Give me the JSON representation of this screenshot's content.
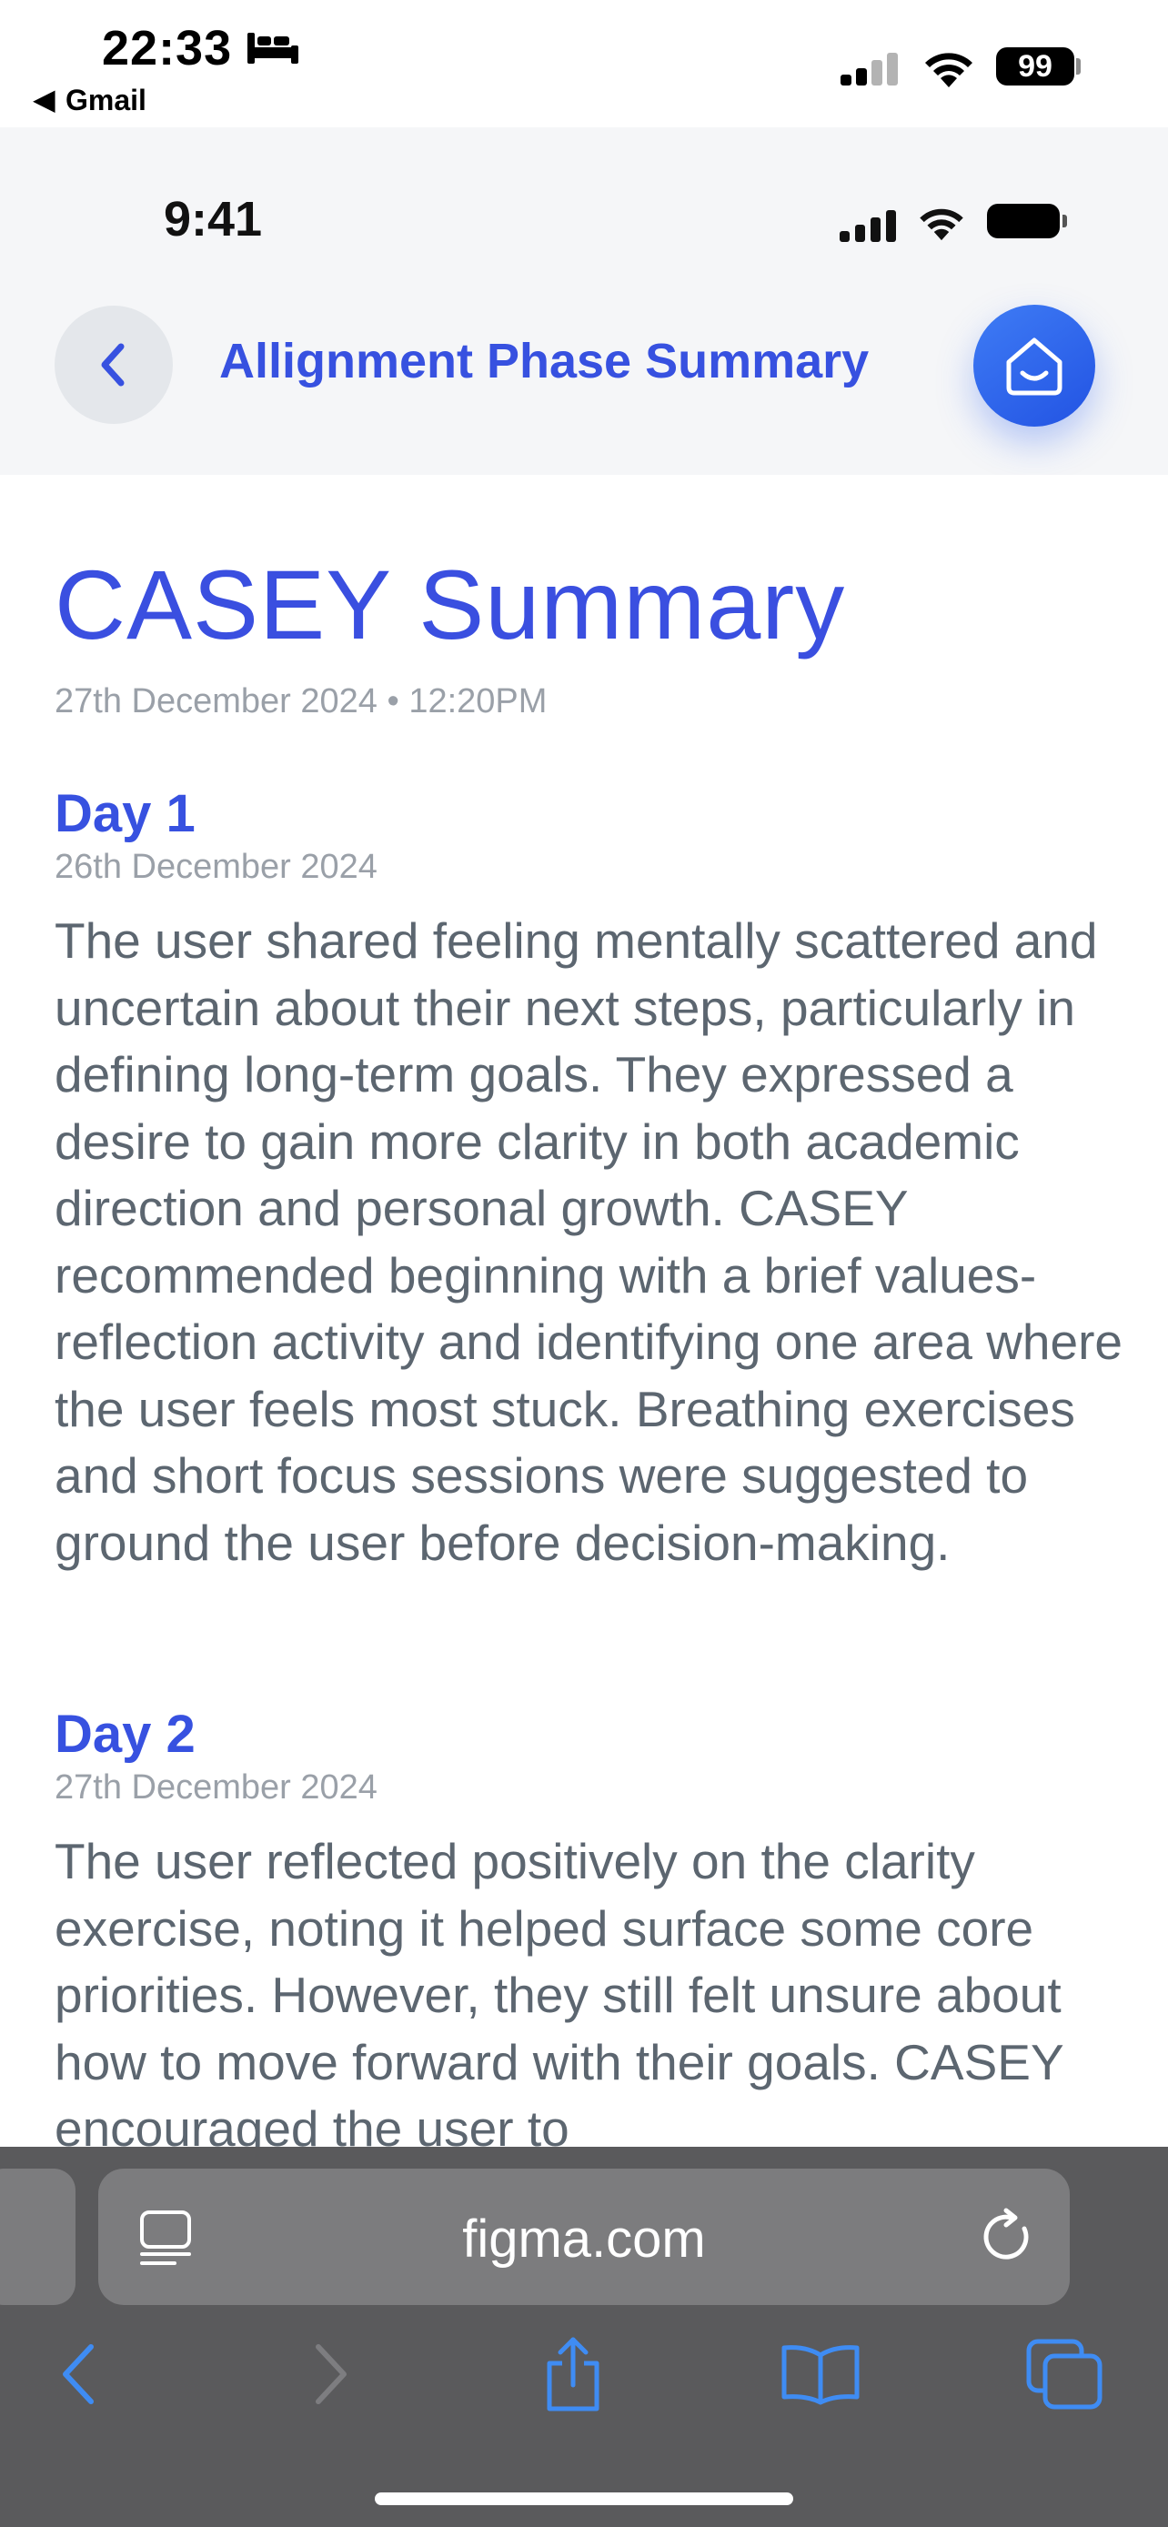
{
  "system_status": {
    "time": "22:33",
    "back_app": "Gmail",
    "battery": "99"
  },
  "prototype": {
    "status_time": "9:41",
    "nav_title": "Allignment Phase Summary"
  },
  "summary": {
    "title": "CASEY Summary",
    "meta": "27th December 2024 • 12:20PM",
    "days": [
      {
        "heading": "Day 1",
        "date": "26th December 2024",
        "text": "The user shared feeling mentally scattered and uncertain about their next steps, particularly in defining long-term goals. They expressed a desire to gain more clarity in both academic direction and personal growth. CASEY recommended beginning with a brief values-reflection activity and identifying one area where the user feels most stuck. Breathing exercises and short focus sessions were suggested to ground the user before decision-making."
      },
      {
        "heading": "Day 2",
        "date": "27th December 2024",
        "text": "The user reflected positively on the clarity exercise, noting it helped surface some core priorities. However, they still felt unsure about how to move forward with their goals. CASEY encouraged the user to"
      }
    ]
  },
  "browser": {
    "url": "figma.com"
  },
  "colors": {
    "accent": "#3751e0",
    "home_button": "#2f66ee",
    "body_text": "#5c6670",
    "muted_text": "#9aa0a8",
    "toolbar_bg": "#5a5a5c",
    "toolbar_icon": "#3f8cf3"
  },
  "icons": [
    "bed-icon",
    "back-triangle-icon",
    "cellular-signal-icon",
    "wifi-icon",
    "battery-icon",
    "chevron-left-icon",
    "home-smile-icon",
    "reader-mode-icon",
    "reload-icon",
    "back-arrow-icon",
    "forward-arrow-icon",
    "share-icon",
    "bookmarks-icon",
    "tabs-icon"
  ]
}
